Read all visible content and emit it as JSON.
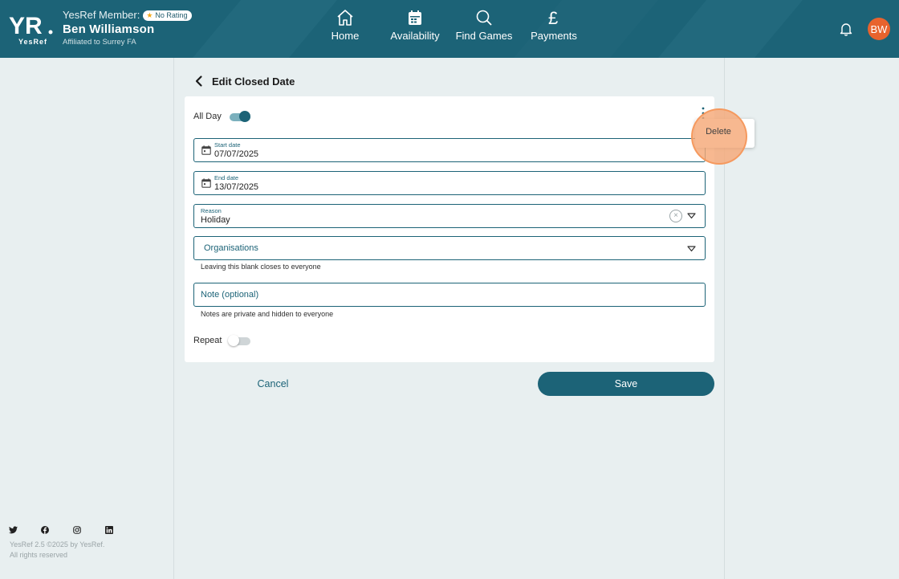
{
  "header": {
    "member_label": "YesRef Member:",
    "rating_badge": "No Rating",
    "user_name": "Ben Williamson",
    "affiliation": "Affiliated to Surrey FA",
    "avatar_initials": "BW",
    "brand_color": "#1c6377",
    "avatar_color": "#e8632e"
  },
  "nav": {
    "home": "Home",
    "availability": "Availability",
    "find_games": "Find Games",
    "payments": "Payments"
  },
  "page": {
    "title": "Edit Closed Date"
  },
  "form": {
    "all_day_label": "All Day",
    "all_day_on": true,
    "start_date_label": "Start date",
    "start_date_value": "07/07/2025",
    "end_date_label": "End date",
    "end_date_value": "13/07/2025",
    "reason_label": "Reason",
    "reason_value": "Holiday",
    "organisations_placeholder": "Organisations",
    "organisations_helper": "Leaving this blank closes to everyone",
    "note_placeholder": "Note (optional)",
    "note_helper": "Notes are private and hidden to everyone",
    "repeat_label": "Repeat",
    "repeat_on": false
  },
  "actions": {
    "cancel": "Cancel",
    "save": "Save"
  },
  "menu": {
    "delete": "Delete"
  },
  "footer": {
    "version": "YesRef 2.5 ©2025 by YesRef.",
    "rights": "All rights reserved",
    "social_icons": [
      "twitter-icon",
      "facebook-icon",
      "instagram-icon",
      "linkedin-icon"
    ]
  }
}
